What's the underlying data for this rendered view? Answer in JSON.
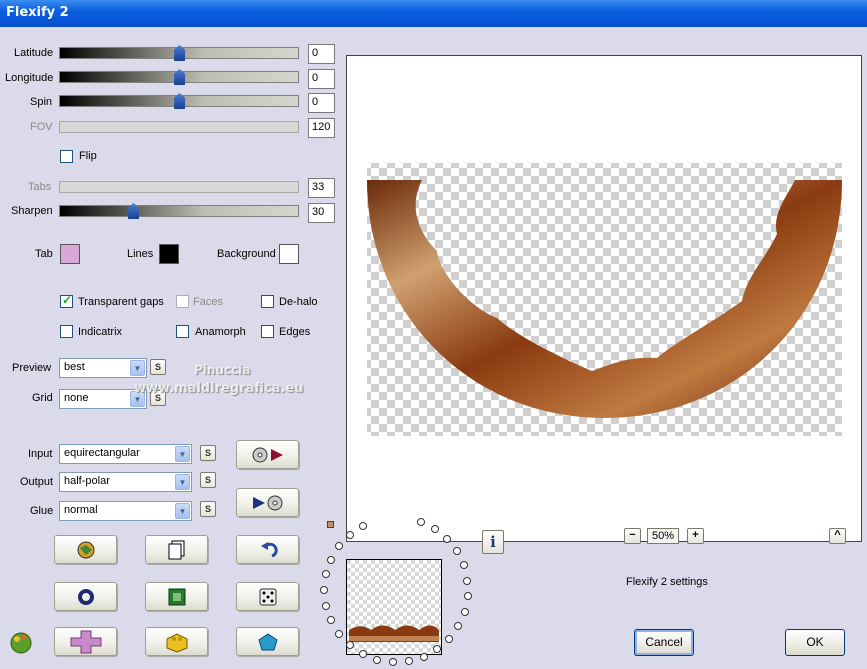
{
  "window": {
    "title": "Flexify 2"
  },
  "sliders": {
    "latitude": {
      "label": "Latitude",
      "value": "0",
      "fraction": 0.5
    },
    "longitude": {
      "label": "Longitude",
      "value": "0",
      "fraction": 0.5
    },
    "spin": {
      "label": "Spin",
      "value": "0",
      "fraction": 0.5
    },
    "fov": {
      "label": "FOV",
      "value": "120"
    },
    "tabs": {
      "label": "Tabs",
      "value": "33"
    },
    "sharpen": {
      "label": "Sharpen",
      "value": "30",
      "fraction": 0.3
    }
  },
  "checkboxes": {
    "flip": {
      "label": "Flip",
      "checked": false
    },
    "transparent_gaps": {
      "label": "Transparent gaps",
      "checked": true
    },
    "faces": {
      "label": "Faces",
      "checked": false
    },
    "dehalo": {
      "label": "De-halo",
      "checked": false
    },
    "indicatrix": {
      "label": "Indicatrix",
      "checked": false
    },
    "anamorph": {
      "label": "Anamorph",
      "checked": false
    },
    "edges": {
      "label": "Edges",
      "checked": false
    }
  },
  "colors": {
    "tab": {
      "label": "Tab",
      "color": "#d8a8d8"
    },
    "lines": {
      "label": "Lines",
      "color": "#000000"
    },
    "background": {
      "label": "Background",
      "color": "#ffffff"
    }
  },
  "dropdowns": {
    "preview": {
      "label": "Preview",
      "value": "best"
    },
    "grid": {
      "label": "Grid",
      "value": "none"
    },
    "input": {
      "label": "Input",
      "value": "equirectangular"
    },
    "output": {
      "label": "Output",
      "value": "half-polar"
    },
    "glue": {
      "label": "Glue",
      "value": "normal"
    }
  },
  "small_button_label": "S",
  "zoom": {
    "value": "50%",
    "minus": "−",
    "plus": "+",
    "up": "^"
  },
  "settings_label": "Flexify 2 settings",
  "info_label": "i",
  "buttons": {
    "cancel": "Cancel",
    "ok": "OK"
  },
  "watermark": {
    "line1": "Pinuccia",
    "line2": "www.maldiregrafica.eu"
  }
}
